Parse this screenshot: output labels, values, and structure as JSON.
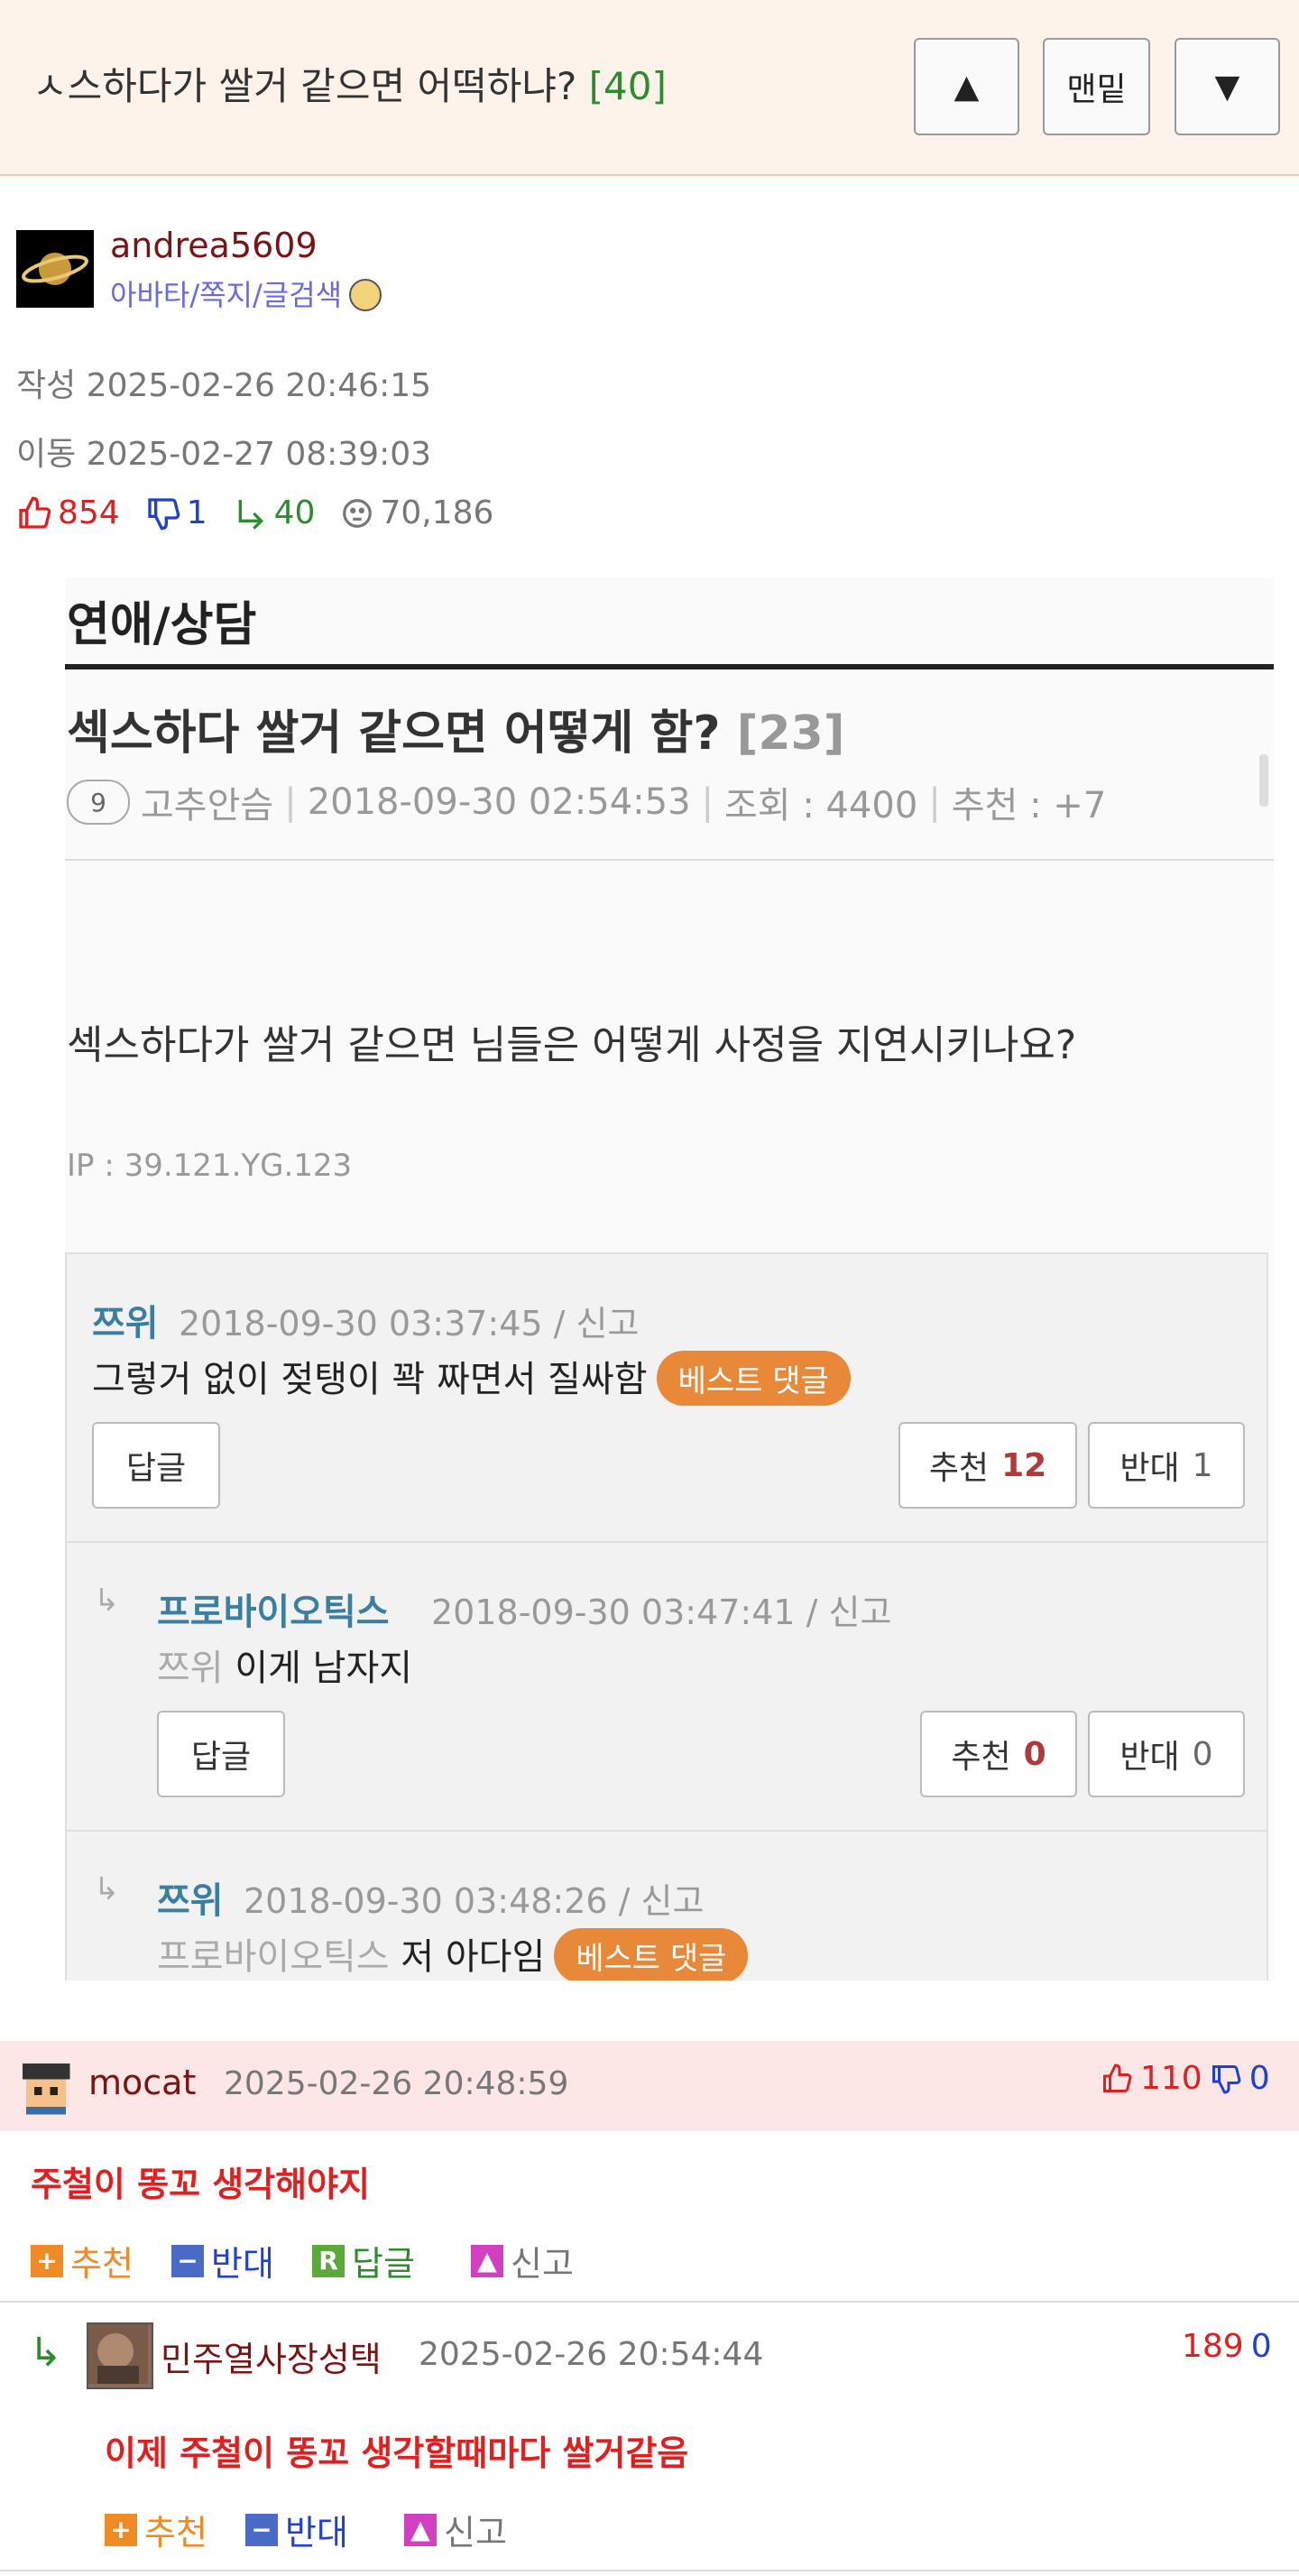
{
  "header": {
    "title": "ㅅ스하다가 쌀거 같으면 어떡하냐?",
    "count": "[40]",
    "btn_up": "▲",
    "btn_bottom": "맨밑",
    "btn_down": "▼"
  },
  "author": {
    "name": "andrea5609",
    "links": "아바타/쪽지/글검색",
    "written": "작성 2025-02-26 20:46:15",
    "moved": "이동 2025-02-27 08:39:03"
  },
  "stats": {
    "up": "854",
    "down": "1",
    "replies": "40",
    "views": "70,186"
  },
  "screenshot": {
    "section": "연애/상담",
    "post_title": "섹스하다 쌀거 같으면 어떻게 함?",
    "post_count": "[23]",
    "level": "9",
    "nickname": "고추안슴",
    "date": "2018-09-30 02:54:53",
    "views": "조회 : 4400",
    "recommend": "추천 : +7",
    "body": "섹스하다가 쌀거 같으면 님들은 어떻게 사정을 지연시키나요?",
    "ip": "IP : 39.121.YG.123",
    "comments": [
      {
        "name": "쯔위",
        "meta": "2018-09-30 03:37:45 / 신고",
        "to": "",
        "text": "그렇거 없이 젖탱이 꽉 짜면서 질싸함",
        "best": "베스트 댓글",
        "reply": "답글",
        "rec_label": "추천",
        "rec": "12",
        "opp_label": "반대",
        "opp": "1"
      },
      {
        "name": "프로바이오틱스",
        "meta": "2018-09-30 03:47:41 / 신고",
        "to": "쯔위",
        "text": "이게 남자지",
        "reply": "답글",
        "rec_label": "추천",
        "rec": "0",
        "opp_label": "반대",
        "opp": "0"
      },
      {
        "name": "쯔위",
        "meta": "2018-09-30 03:48:26 / 신고",
        "to": "프로바이오틱스",
        "text": "저 아다임",
        "best": "베스트 댓글"
      }
    ]
  },
  "comments": [
    {
      "name": "mocat",
      "date": "2025-02-26 20:48:59",
      "up": "110",
      "down": "0",
      "text": "주철이 똥꼬 생각해야지",
      "rec": "추천",
      "opp": "반대",
      "reply": "답글",
      "report": "신고"
    },
    {
      "name": "민주열사장성택",
      "date": "2025-02-26 20:54:44",
      "up": "189",
      "down": "0",
      "text": "이제 주철이 똥꼬 생각할때마다 쌀거같음",
      "rec": "추천",
      "opp": "반대",
      "report": "신고"
    }
  ]
}
